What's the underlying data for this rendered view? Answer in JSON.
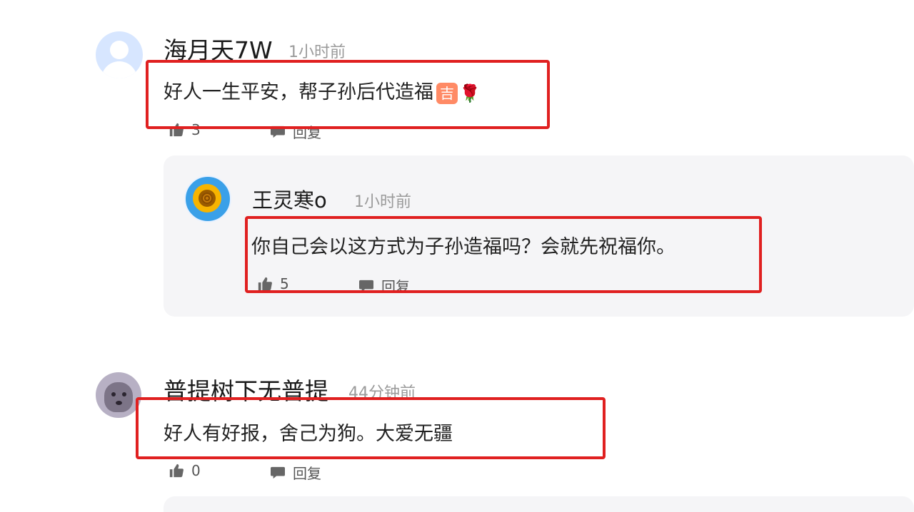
{
  "comments": [
    {
      "username": "海月天7W",
      "time": "1小时前",
      "text": "好人一生平安，帮子孙后代造福",
      "emoji_badge": "吉",
      "emoji_flower": "🌹",
      "likes": "3",
      "reply_label": "回复",
      "avatar": "default-avatar"
    },
    {
      "username": "普提树下无普提",
      "time": "44分钟前",
      "text": "好人有好报，舍己为狗。大爱无疆",
      "likes": "0",
      "reply_label": "回复",
      "avatar": "dog-avatar"
    }
  ],
  "reply": {
    "username": "王灵寒o",
    "time": "1小时前",
    "text": "你自己会以这方式为子孙造福吗？会就先祝福你。",
    "likes": "5",
    "reply_label": "回复",
    "avatar": "sunflower-avatar"
  },
  "colors": {
    "highlight": "#e02020",
    "panel": "#f5f5f7",
    "muted": "#9a9a9a"
  }
}
